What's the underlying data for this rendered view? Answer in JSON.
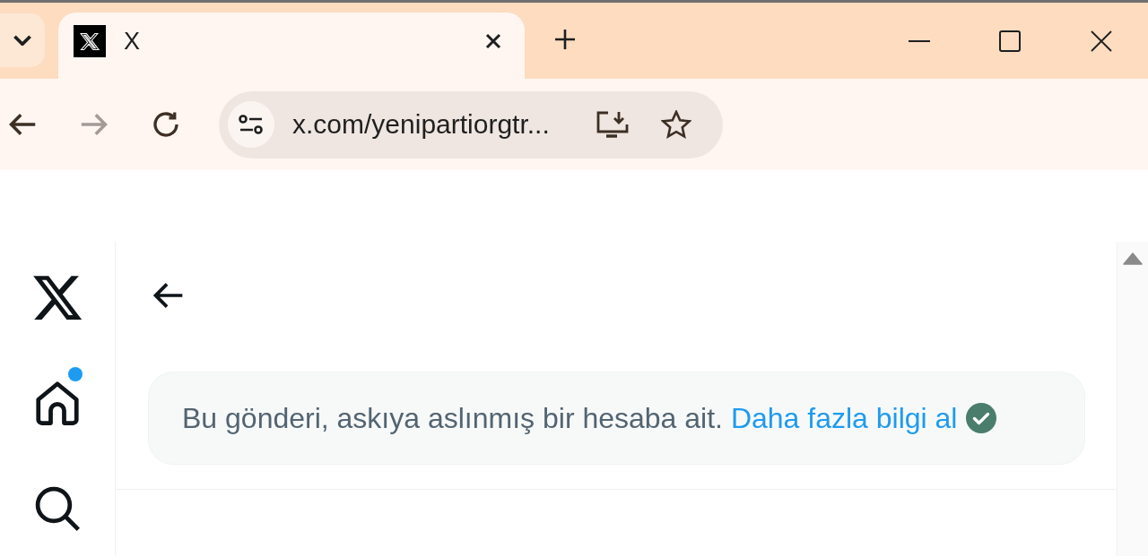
{
  "browser": {
    "tabs": [
      {
        "title": "X",
        "selected": true
      }
    ],
    "toolbar_buttons": [
      {
        "kind": "back",
        "disabled": false
      },
      {
        "kind": "forward",
        "disabled": true
      },
      {
        "kind": "reload",
        "disabled": false
      }
    ],
    "address_bar": {
      "url": "x.com/yenipartiorgtr..."
    }
  },
  "sidebar": {
    "items": [
      {
        "kind": "logo",
        "unread": false
      },
      {
        "kind": "home",
        "unread": true
      },
      {
        "kind": "search",
        "unread": false
      }
    ]
  },
  "notice": {
    "text": "Bu gönderi, askıya aslınmış bir hesaba ait.",
    "link": "Daha fazla bilgi al"
  }
}
